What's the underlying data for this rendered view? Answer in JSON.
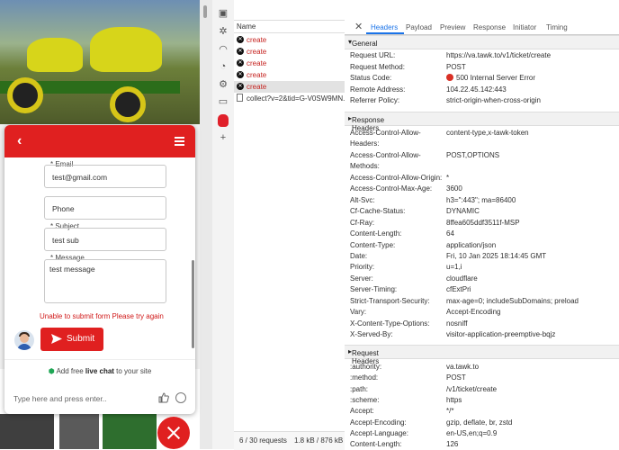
{
  "chat": {
    "email_label": "* Email",
    "email_value": "test@gmail.com",
    "phone_placeholder": "Phone",
    "subject_label": "* Subject",
    "subject_value": "test sub",
    "message_label": "* Message",
    "message_value": "test message",
    "error_text": "Unable to submit form  Please try again",
    "submit_label": "Submit",
    "brand_prefix": "Add free ",
    "brand_bold": "live chat",
    "brand_suffix": " to your site",
    "input_placeholder": "Type here and press enter..",
    "accent_color": "#e02020"
  },
  "network": {
    "column_name": "Name",
    "rows": [
      {
        "name": "create",
        "failed": true
      },
      {
        "name": "create",
        "failed": true
      },
      {
        "name": "create",
        "failed": true
      },
      {
        "name": "create",
        "failed": true
      },
      {
        "name": "create",
        "failed": true,
        "selected": true
      },
      {
        "name": "collect?v=2&tid=G-V0SW9MN...",
        "failed": false
      }
    ],
    "status_requests": "6 / 30 requests",
    "status_transferred": "1.8 kB / 876 kB tr"
  },
  "tabs": [
    "Headers",
    "Payload",
    "Preview",
    "Response",
    "Initiator",
    "Timing"
  ],
  "general": {
    "title": "General",
    "items": [
      {
        "k": "Request URL:",
        "v": "https://va.tawk.to/v1/ticket/create"
      },
      {
        "k": "Request Method:",
        "v": "POST"
      },
      {
        "k": "Status Code:",
        "v": "500 Internal Server Error"
      },
      {
        "k": "Remote Address:",
        "v": "104.22.45.142:443"
      },
      {
        "k": "Referrer Policy:",
        "v": "strict-origin-when-cross-origin"
      }
    ]
  },
  "response": {
    "title": "Response Headers",
    "items": [
      {
        "k": "Access-Control-Allow-",
        "k2": "Headers:",
        "v": "content-type,x-tawk-token"
      },
      {
        "k": "Access-Control-Allow-",
        "k2": "Methods:",
        "v": "POST,OPTIONS"
      },
      {
        "k": "Access-Control-Allow-Origin:",
        "v": "*"
      },
      {
        "k": "Access-Control-Max-Age:",
        "v": "3600"
      },
      {
        "k": "Alt-Svc:",
        "v": "h3=\":443\"; ma=86400"
      },
      {
        "k": "Cf-Cache-Status:",
        "v": "DYNAMIC"
      },
      {
        "k": "Cf-Ray:",
        "v": "8ffea605ddf3511f-MSP"
      },
      {
        "k": "Content-Length:",
        "v": "64"
      },
      {
        "k": "Content-Type:",
        "v": "application/json"
      },
      {
        "k": "Date:",
        "v": "Fri, 10 Jan 2025 18:14:45 GMT"
      },
      {
        "k": "Priority:",
        "v": "u=1,i"
      },
      {
        "k": "Server:",
        "v": "cloudflare"
      },
      {
        "k": "Server-Timing:",
        "v": "cfExtPri"
      },
      {
        "k": "Strict-Transport-Security:",
        "v": "max-age=0; includeSubDomains; preload"
      },
      {
        "k": "Vary:",
        "v": "Accept-Encoding"
      },
      {
        "k": "X-Content-Type-Options:",
        "v": "nosniff"
      },
      {
        "k": "X-Served-By:",
        "v": "visitor-application-preemptive-bqjz"
      }
    ]
  },
  "request": {
    "title": "Request Headers",
    "items": [
      {
        "k": ":authority:",
        "v": "va.tawk.to"
      },
      {
        "k": ":method:",
        "v": "POST"
      },
      {
        "k": ":path:",
        "v": "/v1/ticket/create"
      },
      {
        "k": ":scheme:",
        "v": "https"
      },
      {
        "k": "Accept:",
        "v": "*/*"
      },
      {
        "k": "Accept-Encoding:",
        "v": "gzip, deflate, br, zstd"
      },
      {
        "k": "Accept-Language:",
        "v": "en-US,en;q=0.9"
      },
      {
        "k": "Content-Length:",
        "v": "126"
      }
    ]
  }
}
